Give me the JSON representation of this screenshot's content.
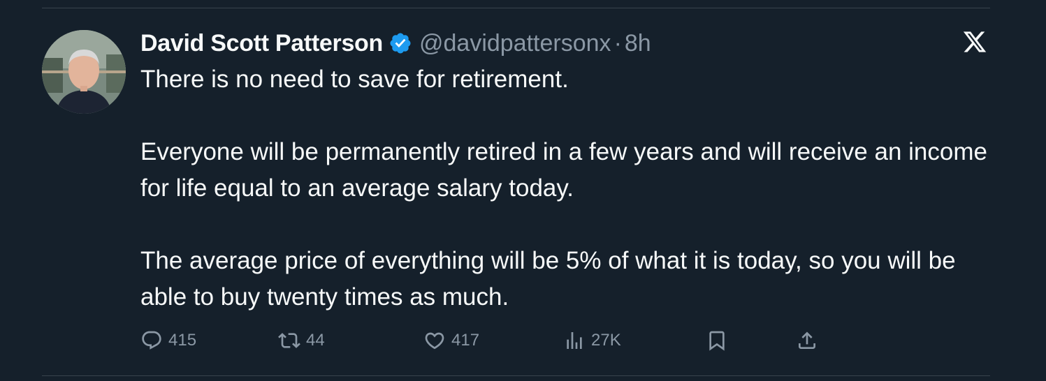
{
  "tweet": {
    "author_name": "David Scott Patterson",
    "handle": "@davidpattersonx",
    "separator": "·",
    "time": "8h",
    "paragraphs": [
      "There is no need to save for retirement.",
      "Everyone will be permanently retired in a few years and will receive an income for life equal to an average salary today.",
      "The average price of everything will be 5% of what it is today, so you will be able to buy twenty times as much."
    ]
  },
  "actions": {
    "replies": "415",
    "reposts": "44",
    "likes": "417",
    "views": "27K"
  },
  "icons": {
    "verified": "verified-badge-icon",
    "platform": "x-logo-icon",
    "reply": "reply-icon",
    "repost": "repost-icon",
    "like": "heart-icon",
    "views": "views-icon",
    "bookmark": "bookmark-icon",
    "share": "share-icon"
  },
  "colors": {
    "background": "#15202b",
    "text": "#f7f9f9",
    "muted": "#8b98a5",
    "verified": "#1d9bf0",
    "divider": "#38444d"
  }
}
